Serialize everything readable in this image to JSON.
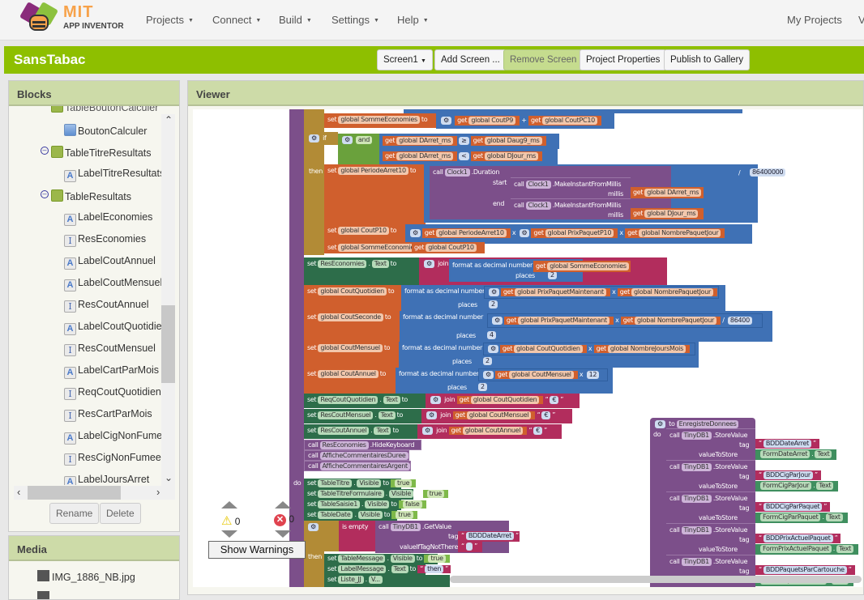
{
  "app": {
    "brand_top": "MIT",
    "brand_bottom": "APP INVENTOR"
  },
  "nav": {
    "menus": [
      "Projects",
      "Connect",
      "Build",
      "Settings",
      "Help"
    ],
    "right": [
      "My Projects",
      "V"
    ]
  },
  "project": {
    "name": "SansTabac",
    "screen_select": "Screen1",
    "buttons": {
      "add_screen": "Add Screen ...",
      "remove_screen": "Remove Screen",
      "project_properties": "Project Properties",
      "publish": "Publish to Gallery"
    }
  },
  "blocks_panel": {
    "title": "Blocks",
    "items": [
      {
        "label": "TableBoutonCalculer",
        "icon": "table-icon",
        "partial": true
      },
      {
        "label": "BoutonCalculer",
        "icon": "button-icon"
      },
      {
        "label": "TableTitreResultats",
        "icon": "horizontal-arrangement-icon",
        "collapsible": true
      },
      {
        "label": "LabelTitreResultats",
        "icon": "label-icon"
      },
      {
        "label": "TableResultats",
        "icon": "table-arrangement-icon",
        "collapsible": true
      },
      {
        "label": "LabelEconomies",
        "icon": "label-icon"
      },
      {
        "label": "ResEconomies",
        "icon": "textbox-icon"
      },
      {
        "label": "LabelCoutAnnuel",
        "icon": "label-icon"
      },
      {
        "label": "LabelCoutMensuel",
        "icon": "label-icon"
      },
      {
        "label": "ResCoutAnnuel",
        "icon": "textbox-icon"
      },
      {
        "label": "LabelCoutQuotidien",
        "icon": "label-icon"
      },
      {
        "label": "ResCoutMensuel",
        "icon": "textbox-icon"
      },
      {
        "label": "LabelCartParMois",
        "icon": "label-icon"
      },
      {
        "label": "ReqCoutQuotidien",
        "icon": "textbox-icon"
      },
      {
        "label": "ResCartParMois",
        "icon": "textbox-icon"
      },
      {
        "label": "LabelCigNonFumee",
        "icon": "label-icon"
      },
      {
        "label": "ResCigNonFumees",
        "icon": "textbox-icon"
      },
      {
        "label": "LabelJoursArret",
        "icon": "label-icon"
      }
    ],
    "rename": "Rename",
    "delete": "Delete"
  },
  "media_panel": {
    "title": "Media",
    "items": [
      "IMG_1886_NB.jpg"
    ]
  },
  "viewer": {
    "title": "Viewer",
    "warnings_count": "0",
    "errors_count": "0",
    "show_warnings": "Show Warnings",
    "blocks": {
      "b1": {
        "kw": "set",
        "var": "global SommeEconomies",
        "to": "to",
        "get1": "global CoutP9",
        "op": "+",
        "get2": "global CoutPC10"
      },
      "if1": {
        "kw": "if",
        "and": "and",
        "get_a": "global DArret_ms",
        "cmp1": "≥",
        "get_b": "global Daug9_ms",
        "get_c": "global DArret_ms",
        "cmp2": "<",
        "get_d": "global DJour_ms",
        "then": "then"
      },
      "b2": {
        "kw": "set",
        "var": "global PeriodeArret10",
        "to": "to",
        "call": "call",
        "comp": "Clock1",
        "method": ".Duration",
        "start": "start",
        "end": "end",
        "make": ".MakeInstantFromMillis",
        "millis": "millis",
        "get_s": "global DArret_ms",
        "get_e": "global DJour_ms",
        "div": "/",
        "num": "86400000"
      },
      "b3": {
        "kw": "set",
        "var": "global CoutP10",
        "to": "to",
        "get1": "global PeriodeArret10",
        "op": "x",
        "get2": "global PrixPaquetP10",
        "op2": "x",
        "get3": "global NombrePaquetJour"
      },
      "b4": {
        "kw": "set",
        "var": "global SommeEconomies",
        "to": "to",
        "get1": "global CoutP10"
      },
      "b5": {
        "kw": "set",
        "comp": "ResEconomies",
        "prop": "Text",
        "to": "to",
        "join": "join",
        "fmt": "format as decimal number",
        "get1": "global SommeEconomies",
        "places": "places",
        "n": "2",
        "str": "€"
      },
      "b6": {
        "kw": "set",
        "var": "global CoutQuotidien",
        "to": "to",
        "fmt": "format as decimal number",
        "get1": "global PrixPaquetMaintenant",
        "op": "x",
        "get2": "global NombrePaquetJour",
        "places": "places",
        "n": "2"
      },
      "b7": {
        "kw": "set",
        "var": "global CoutSeconde",
        "to": "to",
        "fmt": "format as decimal number",
        "get1": "global PrixPaquetMaintenant",
        "op": "x",
        "get2": "global NombrePaquetJour",
        "div": "/",
        "num": "86400",
        "places": "places",
        "n": "4"
      },
      "b8": {
        "kw": "set",
        "var": "global CoutMensuel",
        "to": "to",
        "fmt": "format as decimal number",
        "get1": "global CoutQuotidien",
        "op": "x",
        "get2": "global NombreJoursMois",
        "places": "places",
        "n": "2"
      },
      "b9": {
        "kw": "set",
        "var": "global CoutAnnuel",
        "to": "to",
        "fmt": "format as decimal number",
        "get1": "global CoutMensuel",
        "op": "x",
        "num": "12",
        "places": "places",
        "n": "2"
      },
      "b10": {
        "kw": "set",
        "comp": "ReqCoutQuotidien",
        "prop": "Text",
        "to": "to",
        "join": "join",
        "get1": "global CoutQuotidien",
        "str": "€"
      },
      "b11": {
        "kw": "set",
        "comp": "ResCoutMensuel",
        "prop": "Text",
        "to": "to",
        "join": "join",
        "get1": "global CoutMensuel",
        "str": "€"
      },
      "b12": {
        "kw": "set",
        "comp": "ResCoutAnnuel",
        "prop": "Text",
        "to": "to",
        "join": "join",
        "get1": "global CoutAnnuel",
        "str": "€"
      },
      "c1": {
        "kw": "call",
        "comp": "ResEconomies",
        "method": ".HideKeyboard"
      },
      "c2": {
        "kw": "call",
        "proc": "AfficheCommentairesDuree"
      },
      "c3": {
        "kw": "call",
        "proc": "AfficheCommentairesArgent"
      },
      "do_label": "do",
      "v1": {
        "kw": "set",
        "comp": "TableTitre",
        "prop": "Visible",
        "to": "to",
        "val": "true"
      },
      "v2": {
        "kw": "set",
        "comp": "TableTitreFormulaire",
        "prop": "Visible",
        "to": "to",
        "val": "true"
      },
      "v3": {
        "kw": "set",
        "comp": "TableSaisie1",
        "prop": "Visible",
        "to": "to",
        "val": "false"
      },
      "v4": {
        "kw": "set",
        "comp": "TableDate",
        "prop": "Visible",
        "to": "to",
        "val": "true"
      },
      "if2": {
        "kw": "if",
        "isempty": "is empty",
        "call": "call",
        "comp": "TinyDB1",
        "method": ".GetValue",
        "tag": "tag",
        "tagval": "BDDDateArret",
        "notthere": "valueIfTagNotThere",
        "then": "then"
      },
      "t1": {
        "kw": "set",
        "comp": "TableMessage",
        "prop": "Visible",
        "to": "to",
        "val": "true"
      },
      "t2": {
        "kw": "set",
        "comp": "LabelMessage",
        "prop": "Text",
        "to": "to",
        "str": "then"
      },
      "t3": {
        "kw": "set",
        "comp": "Liste_JJ",
        "prop": "V..."
      },
      "proc": {
        "to": "to",
        "name": "EnregistreDonnees",
        "do": "do",
        "calls": [
          {
            "call": "call",
            "comp": "TinyDB1",
            "method": ".StoreValue",
            "tag": "tag",
            "tagval": "BDDDateArret",
            "vts": "valueToStore",
            "form": "FormDateArret",
            "prop": "Text"
          },
          {
            "call": "call",
            "comp": "TinyDB1",
            "method": ".StoreValue",
            "tag": "tag",
            "tagval": "BDDCigParJour",
            "vts": "valueToStore",
            "form": "FormCigParJour",
            "prop": "Text"
          },
          {
            "call": "call",
            "comp": "TinyDB1",
            "method": ".StoreValue",
            "tag": "tag",
            "tagval": "BDDCigParPaquet",
            "vts": "valueToStore",
            "form": "FormCigParPaquet",
            "prop": "Text"
          },
          {
            "call": "call",
            "comp": "TinyDB1",
            "method": ".StoreValue",
            "tag": "tag",
            "tagval": "BDDPrixActuelPaquet",
            "vts": "valueToStore",
            "form": "FormPrixActuelPaquet",
            "prop": "Text"
          },
          {
            "call": "call",
            "comp": "TinyDB1",
            "method": ".StoreValue",
            "tag": "tag",
            "tagval": "BDDPaquetsParCartouche",
            "vts": "valueToStore",
            "form": "FormPaquetsParCart",
            "prop": "Text"
          }
        ]
      }
    }
  }
}
